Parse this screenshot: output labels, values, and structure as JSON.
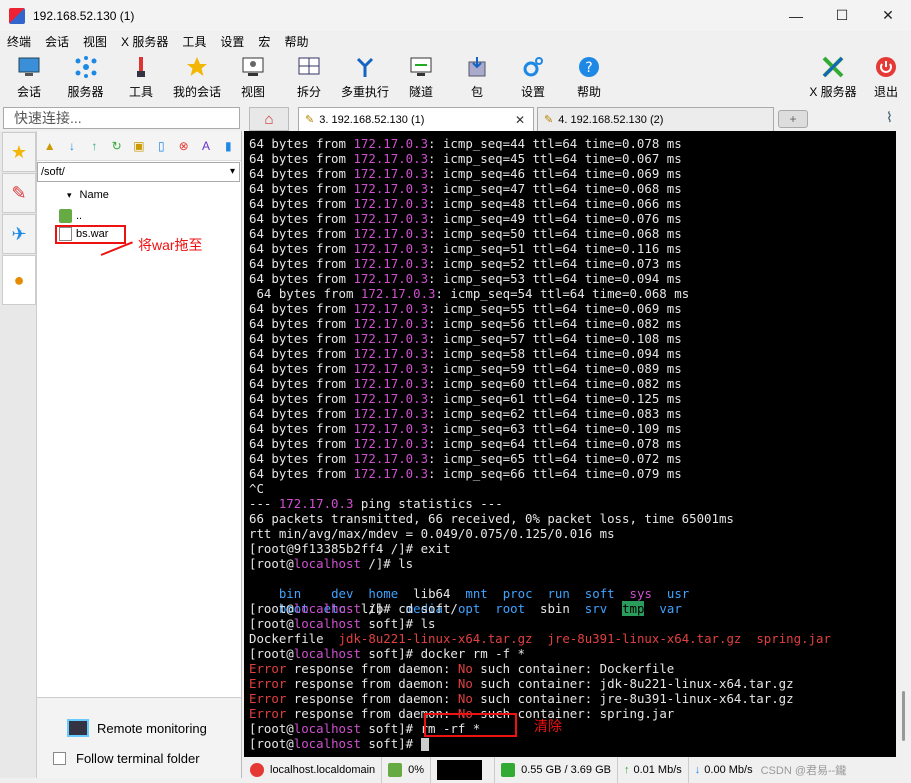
{
  "window": {
    "title": "192.168.52.130 (1)",
    "minimize": "—",
    "maximize": "☐",
    "close": "✕"
  },
  "menu": [
    "终端",
    "会话",
    "视图",
    "X 服务器",
    "工具",
    "设置",
    "宏",
    "帮助"
  ],
  "toolbar": [
    {
      "label": "会话",
      "icon": "monitor-icon"
    },
    {
      "label": "服务器",
      "icon": "servers-icon"
    },
    {
      "label": "工具",
      "icon": "tools-icon"
    },
    {
      "label": "我的会话",
      "icon": "star-icon"
    },
    {
      "label": "视图",
      "icon": "view-icon"
    },
    {
      "label": "拆分",
      "icon": "split-icon"
    },
    {
      "label": "多重执行",
      "icon": "multiexec-icon"
    },
    {
      "label": "隧道",
      "icon": "tunnel-icon"
    },
    {
      "label": "包",
      "icon": "package-icon"
    },
    {
      "label": "设置",
      "icon": "settings-icon"
    },
    {
      "label": "帮助",
      "icon": "help-icon"
    },
    {
      "label": "X 服务器",
      "icon": "xserver-icon"
    },
    {
      "label": "退出",
      "icon": "exit-icon"
    }
  ],
  "quick_connect": {
    "placeholder": "快速连接..."
  },
  "tabs": [
    {
      "label": "3. 192.168.52.130 (1)",
      "active": true
    },
    {
      "label": "4. 192.168.52.130 (2)",
      "active": false
    }
  ],
  "file_panel": {
    "path": "/soft/",
    "column": "Name",
    "files": [
      "..",
      "bs.war"
    ],
    "annotation": "将war拖至",
    "remote_monitoring": "Remote monitoring",
    "follow_folder": "Follow terminal folder"
  },
  "terminal": {
    "ping_prefix": "64 bytes from ",
    "ping_ip": "172.17.0.3",
    "ping_rows": [
      {
        "seq": "44",
        "time": "0.078"
      },
      {
        "seq": "45",
        "time": "0.067"
      },
      {
        "seq": "46",
        "time": "0.069"
      },
      {
        "seq": "47",
        "time": "0.068"
      },
      {
        "seq": "48",
        "time": "0.066"
      },
      {
        "seq": "49",
        "time": "0.076"
      },
      {
        "seq": "50",
        "time": "0.068"
      },
      {
        "seq": "51",
        "time": "0.116"
      },
      {
        "seq": "52",
        "time": "0.073"
      },
      {
        "seq": "53",
        "time": "0.094"
      },
      {
        "seq": "54",
        "time": "0.068",
        "indent": true
      },
      {
        "seq": "55",
        "time": "0.069"
      },
      {
        "seq": "56",
        "time": "0.082"
      },
      {
        "seq": "57",
        "time": "0.108"
      },
      {
        "seq": "58",
        "time": "0.094"
      },
      {
        "seq": "59",
        "time": "0.089"
      },
      {
        "seq": "60",
        "time": "0.082"
      },
      {
        "seq": "61",
        "time": "0.125"
      },
      {
        "seq": "62",
        "time": "0.083"
      },
      {
        "seq": "63",
        "time": "0.109"
      },
      {
        "seq": "64",
        "time": "0.078"
      },
      {
        "seq": "65",
        "time": "0.072"
      },
      {
        "seq": "66",
        "time": "0.079"
      }
    ],
    "ctrl_c": "^C",
    "stats_pre": "--- ",
    "stats_post": " ping statistics ---",
    "stats_line": "66 packets transmitted, 66 received, 0% packet loss, time 65001ms",
    "rtt_line": "rtt min/avg/max/mdev = 0.049/0.075/0.125/0.016 ms",
    "exit_line": "[root@9f13385b2ff4 /]# exit",
    "prompt_open": "[root@",
    "host": "localhost",
    "cmd_ls1": " /]# ls",
    "ls_row1": [
      "bin",
      "dev",
      "home",
      "lib64",
      "mnt",
      "proc",
      "run",
      "soft",
      "sys",
      "usr"
    ],
    "ls_row2": [
      "boot",
      "etc",
      "lib",
      "media",
      "opt",
      "root",
      "sbin",
      "srv",
      "tmp",
      "var"
    ],
    "cmd_cd": " /]# cd soft/",
    "cmd_ls2": " soft]# ls",
    "soft_files": [
      "Dockerfile",
      "jdk-8u221-linux-x64.tar.gz",
      "jre-8u391-linux-x64.tar.gz",
      "spring.jar"
    ],
    "cmd_docker": " soft]# docker rm -f *",
    "error_word": "Error",
    "error_mid": " response from daemon: ",
    "no_word": "No",
    "error_tail": " such container: ",
    "cmd_rm_prompt": " soft]#",
    "cmd_rm": " rm -rf *",
    "rm_annotation": "清除",
    "last_prompt": " soft]# "
  },
  "status": {
    "host": "localhost.localdomain",
    "cpu": "0%",
    "memory": "0.55 GB / 3.69 GB",
    "upload": "0.01 Mb/s",
    "download": "0.00 Mb/s",
    "watermark": "CSDN @君易--鑨"
  }
}
